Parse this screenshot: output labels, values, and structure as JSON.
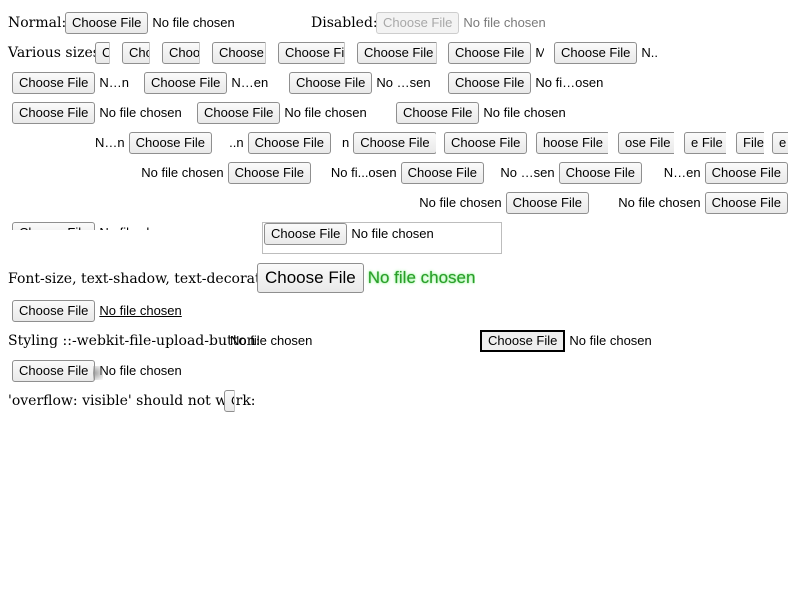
{
  "button_label": "Choose File",
  "status_full": "No file chosen",
  "labels": {
    "normal": "Normal:",
    "disabled": "Disabled:",
    "various_sizes": "Various sizes:",
    "font_section": "Font-size, text-shadow, text-decoration:",
    "styling_section": "Styling ::-webkit-file-upload-button:",
    "styling_status": "No file chosen",
    "overflow_section": "'overflow: visible' should not work:"
  },
  "status_variants": {
    "n_dot": "N..",
    "n_n": "N…n",
    "n_en": "N…en",
    "no_sen": "No …sen",
    "no_fi_osen": "No fi…osen",
    "no_fi_osen_b": "No fi...osen",
    "no_sen_b": "No …sen",
    "n_en_b": "N…en",
    "n_n_rtl": "N…n",
    "dots_n": "..n",
    "single_n": "n",
    "single_m": "M"
  },
  "rtl_button_fragments": {
    "hoose": "hoose File",
    "ose": "ose File",
    "e": "e File",
    "file": "File",
    "single_e": "e"
  },
  "truncated_buttons": {
    "c": "C",
    "che": "Che",
    "choo": "Choo",
    "choose": "Choose",
    "choose_fi": "Choose Fi"
  },
  "partial_row": {
    "button": "Choose File",
    "status": "No file chosen"
  }
}
